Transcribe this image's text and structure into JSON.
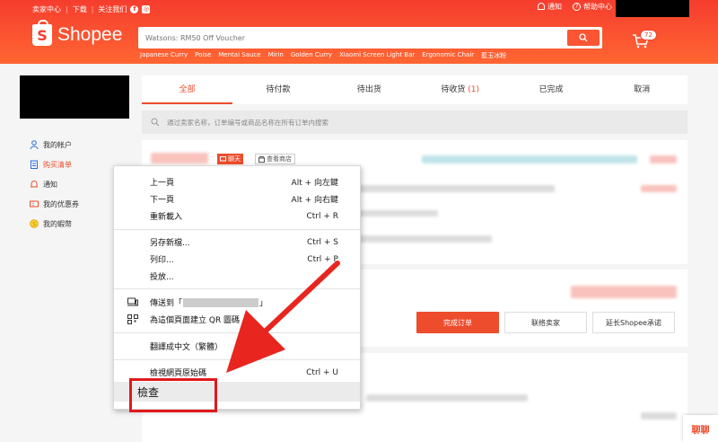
{
  "topbar": {
    "seller_center": "卖家中心",
    "download": "下载",
    "follow": "关注我们",
    "facebook_glyph": "f",
    "instagram_glyph": "◎",
    "notifications": "通知",
    "help": "帮助中心"
  },
  "header": {
    "brand": "Shopee",
    "brand_glyph": "S",
    "search_placeholder": "Watsons: RM50 Off Voucher",
    "hints": [
      "Japanese Curry",
      "Poise",
      "Mentai Sauce",
      "Mirin",
      "Golden Curry",
      "Xiaomi Screen Light Bar",
      "Ergonomic Chair",
      "藍玉冰粉"
    ],
    "cart_count": "72",
    "accent": "#ee4d2d"
  },
  "sidebar": {
    "items": [
      {
        "label": "我的帐户",
        "icon": "user-icon"
      },
      {
        "label": "购买清单",
        "icon": "clipboard-icon"
      },
      {
        "label": "通知",
        "icon": "bell-icon"
      },
      {
        "label": "我的优惠券",
        "icon": "ticket-icon"
      },
      {
        "label": "我的蝦幣",
        "icon": "coin-icon"
      }
    ]
  },
  "tabs": [
    {
      "label": "全部"
    },
    {
      "label": "待付款"
    },
    {
      "label": "待出货"
    },
    {
      "label": "待收货",
      "count": "(1)"
    },
    {
      "label": "已完成"
    },
    {
      "label": "取消"
    }
  ],
  "order_search_placeholder": "通过卖家名称，订单编号或商品名称在所有订单内搜索",
  "card1": {
    "chat_label": "聊天",
    "shop_label": "查看商店"
  },
  "card2": {
    "complete_button": "完成订单",
    "contact_button": "联络卖家",
    "extend_button": "延长Shopee承诺"
  },
  "context_menu": {
    "back": {
      "label": "上一頁",
      "shortcut": "Alt + 向左鍵"
    },
    "forward": {
      "label": "下一頁",
      "shortcut": "Alt + 向右鍵"
    },
    "reload": {
      "label": "重新載入",
      "shortcut": "Ctrl + R"
    },
    "save_as": {
      "label": "另存新檔...",
      "shortcut": "Ctrl + S"
    },
    "print": {
      "label": "列印...",
      "shortcut": "Ctrl + P"
    },
    "cast": {
      "label": "投放..."
    },
    "send_to_prefix": "傳送到「",
    "send_to_suffix": "」",
    "qr": {
      "label": "為這個頁面建立 QR 圖碼"
    },
    "translate": {
      "label": "翻譯成中文（繁體）"
    },
    "view_source": {
      "label": "檢視網頁原始碼",
      "shortcut": "Ctrl + U"
    },
    "inspect": {
      "label": "檢查"
    }
  },
  "chat_float": "聊聊",
  "highlight_color": "#e0191c"
}
